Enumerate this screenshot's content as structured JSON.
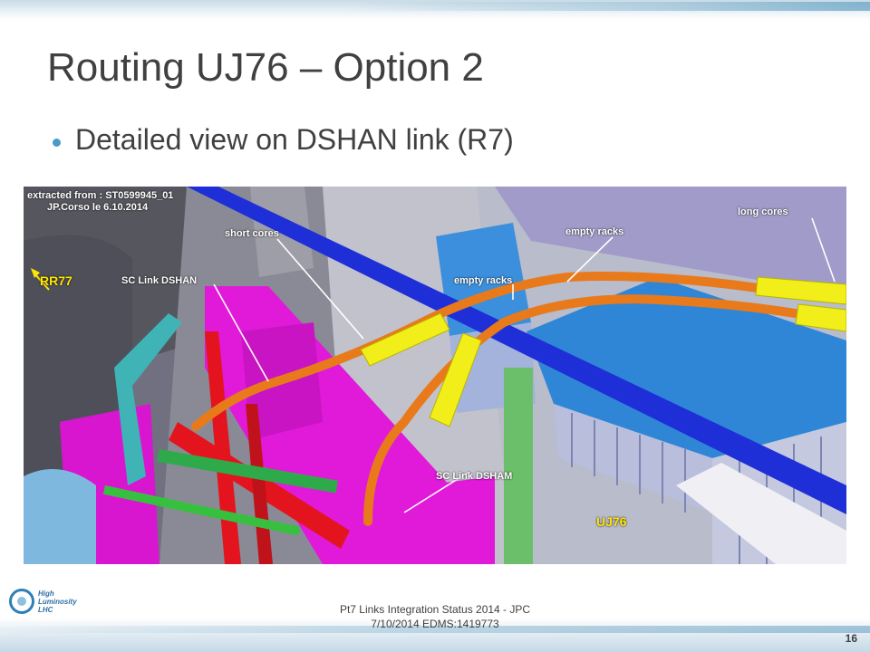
{
  "slide": {
    "title": "Routing UJ76 – Option 2",
    "bullet": "Detailed view on DSHAN link (R7)",
    "footer_line1": "Pt7 Links Integration Status 2014 - JPC",
    "footer_line2": "7/10/2014  EDMS:1419773",
    "page_number": "16",
    "logo_lines": [
      "High",
      "Luminosity",
      "LHC"
    ]
  },
  "figure": {
    "extract_line1": "extracted from : ST0599945_01",
    "extract_line2": "JP.Corso le 6.10.2014",
    "labels": {
      "rr77": "RR77",
      "short_cores": "short cores",
      "sc_link_dshan": "SC Link DSHAN",
      "empty_racks_top": "empty racks",
      "empty_racks_mid": "empty racks",
      "long_cores": "long cores",
      "sc_link_dsham": "SC Link DSHAM",
      "uj76": "UJ76"
    }
  },
  "colors": {
    "title_text": "#404040",
    "bullet_accent": "#4a9ac9",
    "cable_orange": "#e87a1c",
    "sleeve_yellow": "#f2ee1a",
    "rack_blue": "#2f86d6",
    "beam_blue": "#1f2fd8",
    "magenta_structure": "#e01ad8",
    "red_structure": "#e3141e",
    "label_yellow": "#ffe600"
  }
}
